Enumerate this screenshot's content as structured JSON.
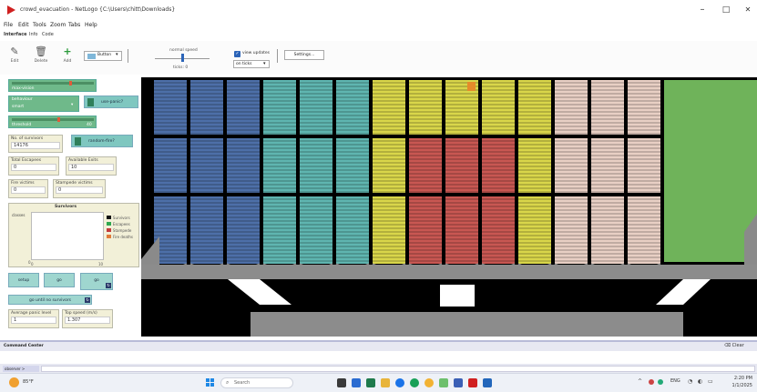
{
  "window": {
    "title": "crowd_evacuation - NetLogo {C:\\Users\\chitt\\Downloads}",
    "minimize": "–",
    "maximize": "□",
    "close": "✕"
  },
  "menu": [
    "File",
    "Edit",
    "Tools",
    "Zoom",
    "Tabs",
    "Help"
  ],
  "tabs": [
    "Interface",
    "Info",
    "Code"
  ],
  "toolbar": {
    "edit_label": "Edit",
    "delete_label": "Delete",
    "add_label": "Add",
    "widget_type": "Button",
    "speed_label": "normal speed",
    "ticks_label": "ticks: 0",
    "view_updates_label": "view updates",
    "view_updates_checked": true,
    "update_mode": "on ticks",
    "settings_label": "Settings..."
  },
  "controls": {
    "slider1_label": "max-vision",
    "slider1_fill": 0.7,
    "behaviour_label": "behaviour",
    "behaviour_value": "smart",
    "use_panic_label": "use-panic?",
    "slider2_label": "threshold",
    "slider2_value": "40",
    "slider2_fill": 0.55,
    "survivors_label": "No. of survivors",
    "survivors_value": "14176",
    "random_fire_label": "random-fire?",
    "total_escapees_label": "Total Escapees",
    "total_escapees_value": "0",
    "available_exits_label": "Available Exits",
    "available_exits_value": "10",
    "fire_victims_label": "Fire victims",
    "fire_victims_value": "0",
    "stampede_victims_label": "Stampede victims",
    "stampede_victims_value": "0",
    "plot_title": "Survivors",
    "plot_ylabel": "classes",
    "plot_x_min": "0",
    "plot_x_max": "10",
    "plot_y_min": "0",
    "legend": [
      {
        "label": "Survivors",
        "color": "#111111"
      },
      {
        "label": "Escapees",
        "color": "#2fa84f"
      },
      {
        "label": "Stampede",
        "color": "#c23b3b"
      },
      {
        "label": "Fire deaths",
        "color": "#e07b39"
      }
    ],
    "setup_label": "setup",
    "go_label": "go",
    "go_forever_label": "go",
    "go_until_label": "go until no survivors",
    "avg_panic_label": "Average panic level",
    "avg_panic_value": "1",
    "top_speed_label": "Top speed (m/s)",
    "top_speed_value": "1.307"
  },
  "command_center": {
    "title": "Command Center",
    "clear_label": "Clear",
    "observer_label": "observer >"
  },
  "taskbar": {
    "weather": "85°F",
    "search_placeholder": "Search",
    "lang": "ENG",
    "time": "2:20 PM",
    "date": "1/1/2025"
  },
  "colors": {
    "blue": "#4d6fa8",
    "teal": "#5fb5b0",
    "yellow": "#d9d64a",
    "red": "#c85752",
    "pink": "#e8cfc4",
    "green": "#6fb35a",
    "fire": "#e58a2a"
  }
}
